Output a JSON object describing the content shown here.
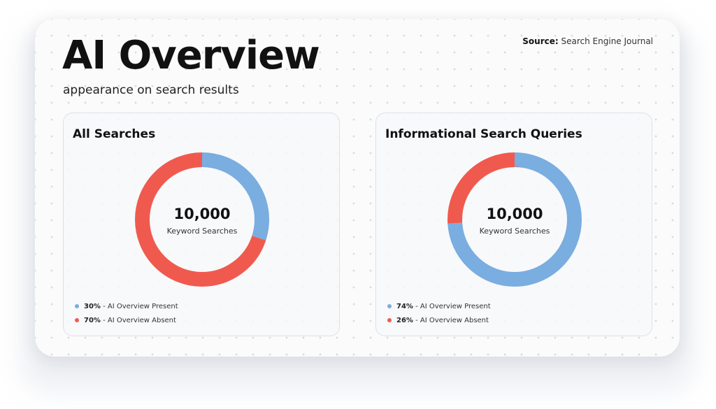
{
  "title": "AI Overview",
  "subtitle": "appearance on search results",
  "source": {
    "label": "Source:",
    "text": "Search Engine Journal"
  },
  "colors": {
    "present": "#7aade0",
    "absent": "#f05a4e"
  },
  "chart_data": [
    {
      "type": "pie",
      "title": "All Searches",
      "center_value": "10,000",
      "center_label": "Keyword Searches",
      "slices": [
        {
          "pct": "30%",
          "label": "AI Overview Present",
          "value": 30,
          "color": "#7aade0"
        },
        {
          "pct": "70%",
          "label": "AI Overview Absent",
          "value": 70,
          "color": "#f05a4e"
        }
      ]
    },
    {
      "type": "pie",
      "title": "Informational Search Queries",
      "center_value": "10,000",
      "center_label": "Keyword Searches",
      "slices": [
        {
          "pct": "74%",
          "label": "AI Overview Present",
          "value": 74,
          "color": "#7aade0"
        },
        {
          "pct": "26%",
          "label": "AI Overview Absent",
          "value": 26,
          "color": "#f05a4e"
        }
      ]
    }
  ]
}
